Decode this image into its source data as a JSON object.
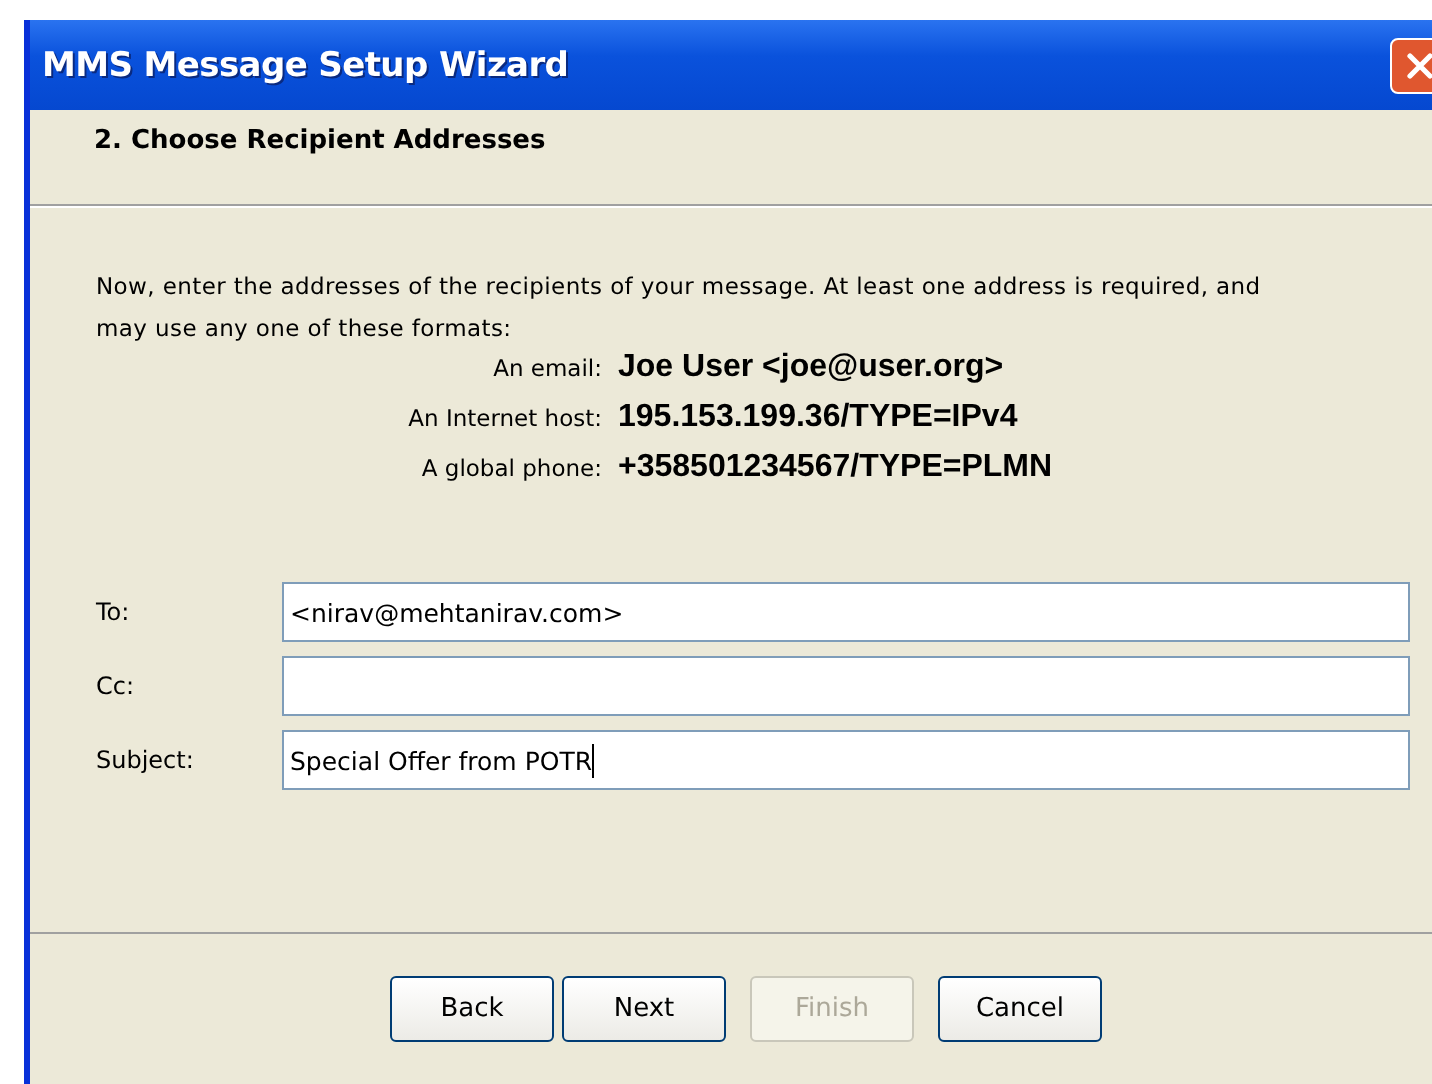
{
  "window": {
    "title": "MMS Message Setup Wizard"
  },
  "step": {
    "title": "2. Choose Recipient Addresses"
  },
  "intro": "Now, enter the addresses of the recipients of your message. At least one address is required, and may use any one of these formats:",
  "formats": [
    {
      "label": "An email:",
      "example": "Joe User <joe@user.org>"
    },
    {
      "label": "An Internet host:",
      "example": "195.153.199.36/TYPE=IPv4"
    },
    {
      "label": "A global phone:",
      "example": "+358501234567/TYPE=PLMN"
    }
  ],
  "fields": [
    {
      "label": "To:",
      "value": "<nirav@mehtanirav.com>",
      "focused": false
    },
    {
      "label": "Cc:",
      "focused": false
    },
    {
      "label": "Subject:",
      "value": "Special Offer from POTR",
      "focused": true
    }
  ],
  "buttons": [
    {
      "label": "Back",
      "disabled": false
    },
    {
      "label": "Next",
      "disabled": false
    },
    {
      "label": "Finish",
      "disabled": true
    },
    {
      "label": "Cancel",
      "disabled": false
    }
  ]
}
